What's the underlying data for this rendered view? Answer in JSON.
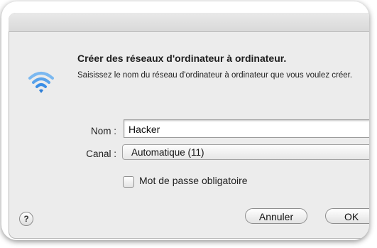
{
  "dialog": {
    "title": "Créer des réseaux d'ordinateur à ordinateur.",
    "description": "Saisissez le nom du réseau d'ordinateur à ordinateur que vous voulez créer."
  },
  "form": {
    "name_label": "Nom :",
    "name_value": "Hacker",
    "channel_label": "Canal :",
    "channel_value": "Automatique (11)",
    "password_checkbox_label": "Mot de passe obligatoire",
    "password_checked": false
  },
  "buttons": {
    "help": "?",
    "cancel": "Annuler",
    "ok": "OK"
  },
  "icons": {
    "wifi": "wifi-icon",
    "help": "help-icon"
  },
  "colors": {
    "wifi_blue": "#3a8ee6",
    "sheet_bg": "#ececec"
  }
}
